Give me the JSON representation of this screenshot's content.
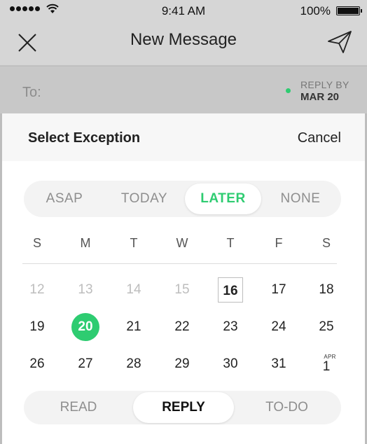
{
  "status_bar": {
    "time": "9:41 AM",
    "battery_percent": "100%",
    "battery_level": 1.0,
    "signal_icon": "signal-dots-icon",
    "wifi_icon": "wifi-icon"
  },
  "nav": {
    "title": "New Message",
    "close_icon": "close-icon",
    "send_icon": "send-icon"
  },
  "to_row": {
    "label": "To:",
    "reply_by_label": "REPLY BY",
    "reply_by_date": "MAR 20"
  },
  "sheet": {
    "title": "Select Exception",
    "cancel_label": "Cancel",
    "timing_tabs": [
      {
        "label": "ASAP",
        "active": false
      },
      {
        "label": "TODAY",
        "active": false
      },
      {
        "label": "LATER",
        "active": true
      },
      {
        "label": "NONE",
        "active": false
      }
    ],
    "weekdays": [
      "S",
      "M",
      "T",
      "W",
      "T",
      "F",
      "S"
    ],
    "weeks": [
      [
        {
          "day": "12",
          "state": "past"
        },
        {
          "day": "13",
          "state": "past"
        },
        {
          "day": "14",
          "state": "past"
        },
        {
          "day": "15",
          "state": "past"
        },
        {
          "day": "16",
          "state": "today"
        },
        {
          "day": "17",
          "state": "normal"
        },
        {
          "day": "18",
          "state": "normal"
        }
      ],
      [
        {
          "day": "19",
          "state": "normal"
        },
        {
          "day": "20",
          "state": "selected"
        },
        {
          "day": "21",
          "state": "normal"
        },
        {
          "day": "22",
          "state": "normal"
        },
        {
          "day": "23",
          "state": "normal"
        },
        {
          "day": "24",
          "state": "normal"
        },
        {
          "day": "25",
          "state": "normal"
        }
      ],
      [
        {
          "day": "26",
          "state": "normal"
        },
        {
          "day": "27",
          "state": "normal"
        },
        {
          "day": "28",
          "state": "normal"
        },
        {
          "day": "29",
          "state": "normal"
        },
        {
          "day": "30",
          "state": "normal"
        },
        {
          "day": "31",
          "state": "normal"
        },
        {
          "day": "1",
          "state": "normal",
          "month": "APR"
        }
      ]
    ],
    "type_tabs": [
      {
        "label": "READ",
        "active": false
      },
      {
        "label": "REPLY",
        "active": true
      },
      {
        "label": "TO-DO",
        "active": false
      }
    ]
  },
  "colors": {
    "accent": "#2ecc71",
    "muted": "#8e8e8e",
    "header_gray": "#d6d6d6"
  }
}
